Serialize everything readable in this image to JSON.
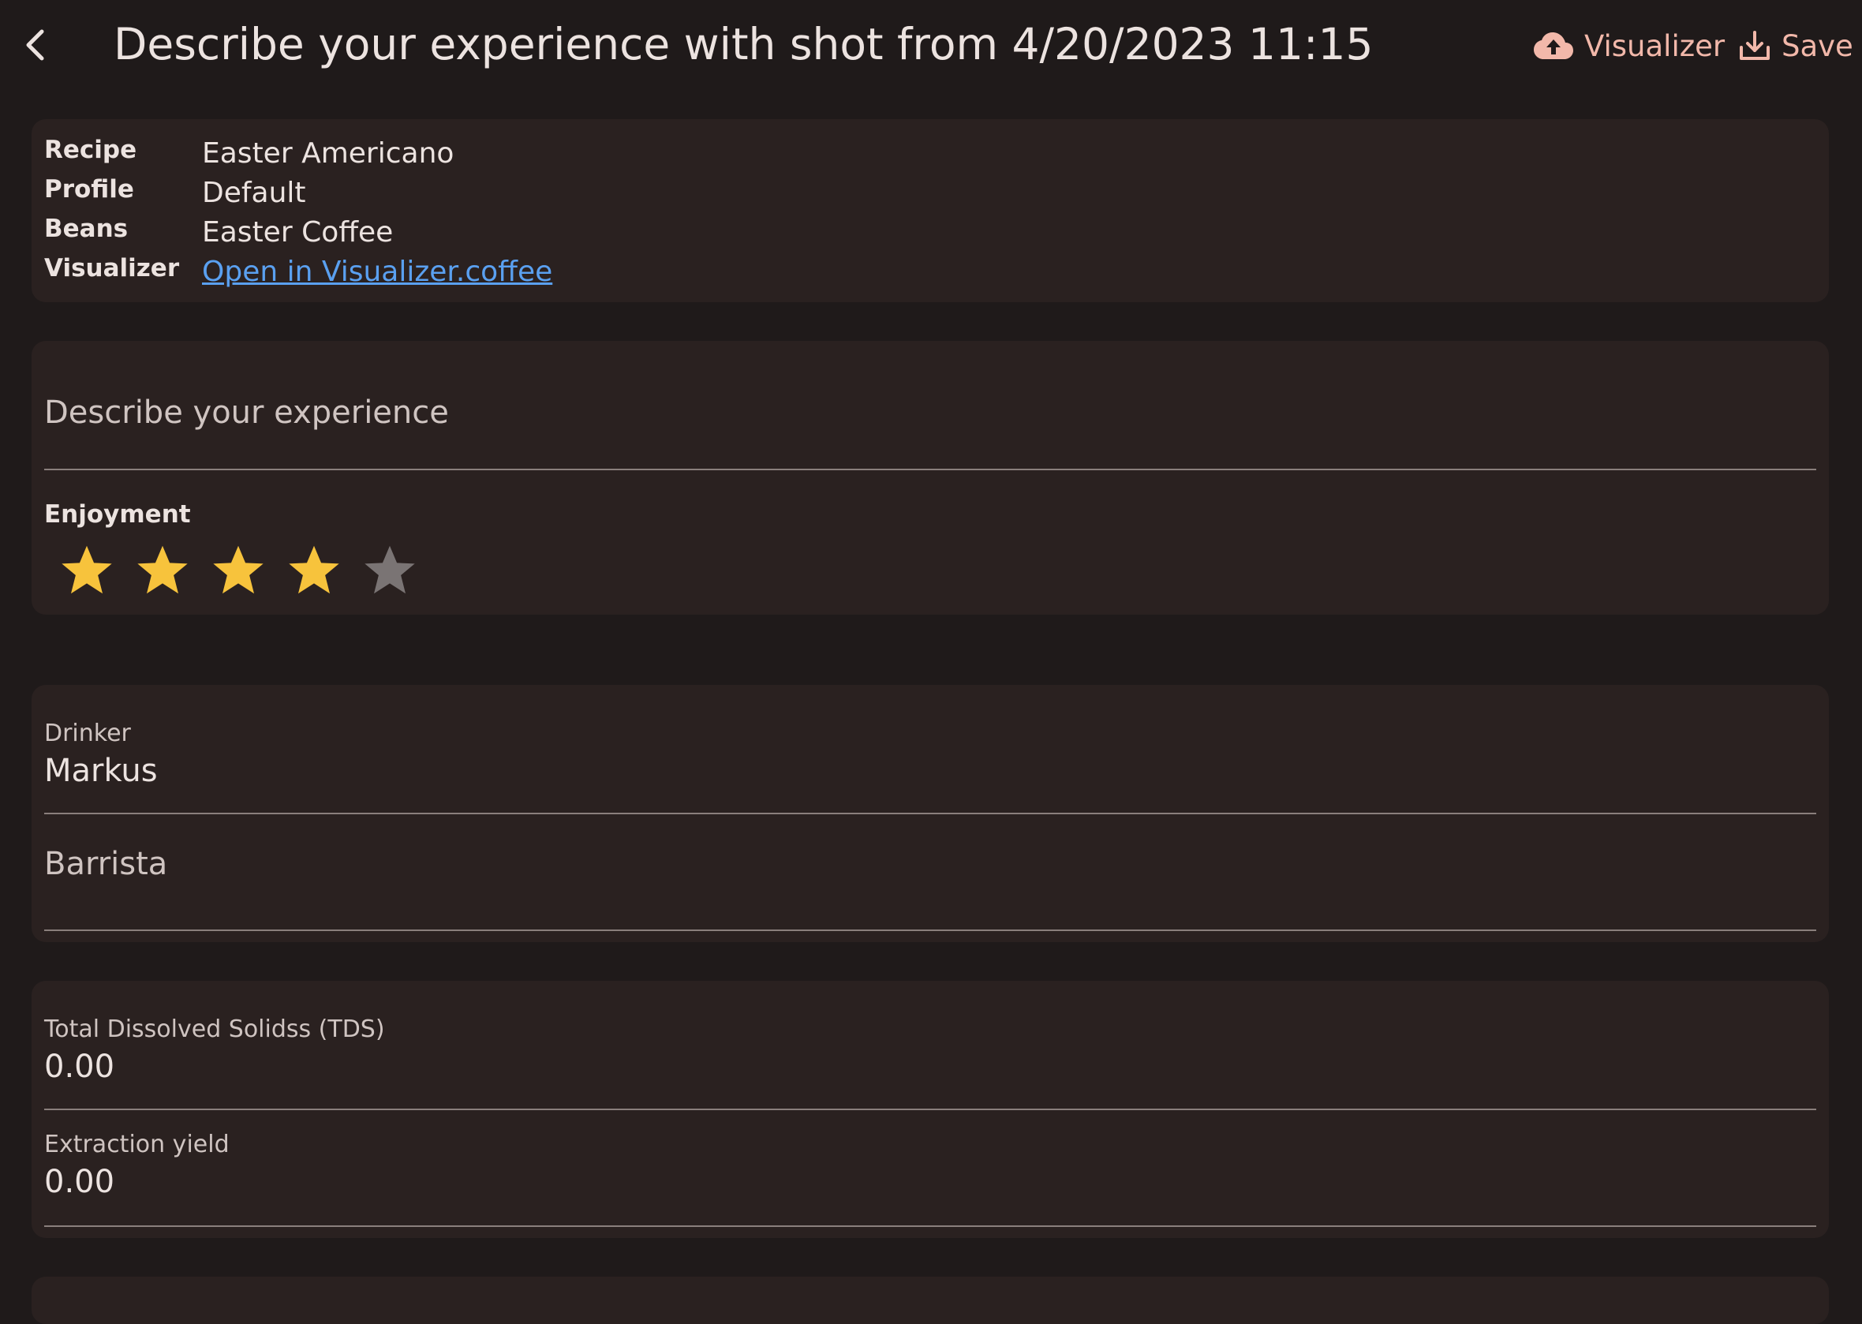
{
  "header": {
    "title": "Describe your experience with shot from 4/20/2023 11:15",
    "visualizer_label": "Visualizer",
    "save_label": "Save"
  },
  "info": {
    "rows": [
      {
        "label": "Recipe",
        "value": "Easter Americano"
      },
      {
        "label": "Profile",
        "value": "Default"
      },
      {
        "label": "Beans",
        "value": "Easter Coffee"
      },
      {
        "label": "Visualizer",
        "value": "Open in Visualizer.coffee"
      }
    ]
  },
  "experience": {
    "placeholder": "Describe your experience",
    "enjoyment_label": "Enjoyment",
    "rating": 4,
    "max_rating": 5
  },
  "people": {
    "drinker_label": "Drinker",
    "drinker_value": "Markus",
    "barista_placeholder": "Barrista"
  },
  "extraction": {
    "tds_label": "Total Dissolved Solidss (TDS)",
    "tds_value": "0.00",
    "ey_label": "Extraction yield",
    "ey_value": "0.00"
  },
  "colors": {
    "background": "#1f1a1a",
    "card": "#2a2120",
    "accent": "#f2b8aa",
    "link": "#5aa0f0",
    "star_on": "#f7c33c",
    "star_off": "#7a7474"
  },
  "icons": {
    "back": "chevron-left-icon",
    "visualizer": "cloud-upload-icon",
    "save": "download-icon",
    "star": "star-icon"
  }
}
